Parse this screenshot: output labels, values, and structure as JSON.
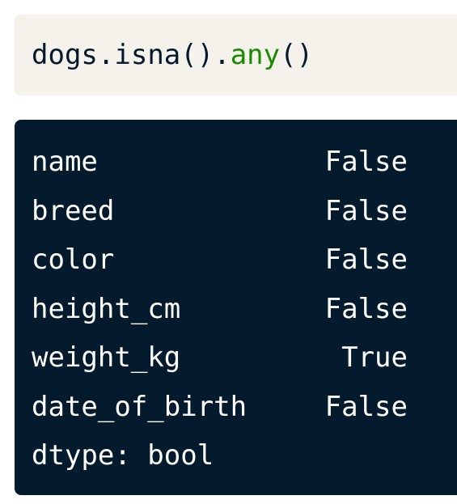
{
  "code": {
    "obj": "dogs",
    "dot1": ".",
    "method": "isna",
    "call1": "()",
    "dot2": ".",
    "fn": "any",
    "call2": "()"
  },
  "output": {
    "rows": [
      {
        "name": "name",
        "value": "False"
      },
      {
        "name": "breed",
        "value": "False"
      },
      {
        "name": "color",
        "value": "False"
      },
      {
        "name": "height_cm",
        "value": "False"
      },
      {
        "name": "weight_kg",
        "value": "True"
      },
      {
        "name": "date_of_birth",
        "value": "False"
      }
    ],
    "dtype": "dtype: bool"
  },
  "colors": {
    "code_bg": "#f5f2eb",
    "code_text": "#05192d",
    "code_fn": "#1a8a00",
    "output_bg": "#041a2d",
    "output_text": "#ffffff"
  }
}
